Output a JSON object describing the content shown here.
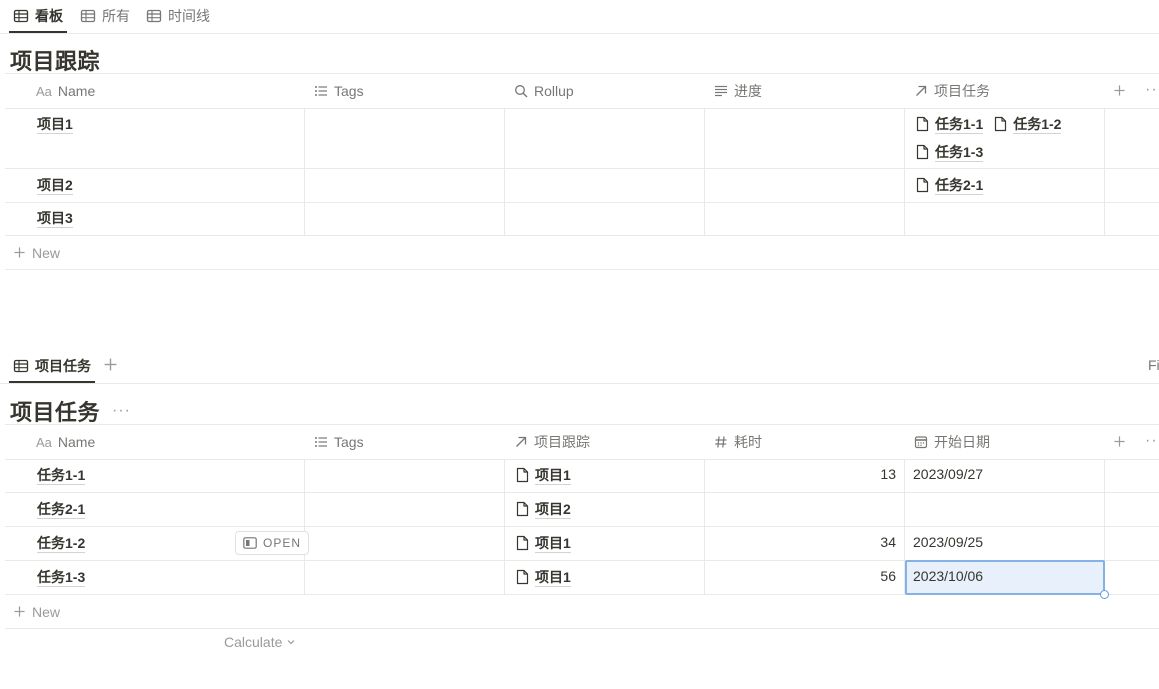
{
  "view1": {
    "tabs": [
      {
        "label": "看板",
        "active": true
      },
      {
        "label": "所有",
        "active": false
      },
      {
        "label": "时间线",
        "active": false
      }
    ],
    "title": "项目跟踪",
    "columns": [
      "Name",
      "Tags",
      "Rollup",
      "进度",
      "项目任务"
    ],
    "name_prefix": "Aa",
    "rows": [
      {
        "name": "项目1",
        "relations": [
          "任务1-1",
          "任务1-2",
          "任务1-3"
        ]
      },
      {
        "name": "项目2",
        "relations": [
          "任务2-1"
        ]
      },
      {
        "name": "项目3",
        "relations": []
      }
    ],
    "new_label": "New"
  },
  "view2": {
    "tabs": [
      {
        "label": "项目任务",
        "active": true
      }
    ],
    "right_clip": "Fi",
    "title": "项目任务",
    "more": "···",
    "columns": [
      "Name",
      "Tags",
      "项目跟踪",
      "耗时",
      "开始日期"
    ],
    "name_prefix": "Aa",
    "rows": [
      {
        "name": "任务1-1",
        "project": "项目1",
        "duration": "13",
        "date": "2023/09/27"
      },
      {
        "name": "任务2-1",
        "project": "项目2",
        "duration": "",
        "date": ""
      },
      {
        "name": "任务1-2",
        "project": "项目1",
        "duration": "34",
        "date": "2023/09/25"
      },
      {
        "name": "任务1-3",
        "project": "项目1",
        "duration": "56",
        "date": "2023/10/06"
      }
    ],
    "open_label": "OPEN",
    "new_label": "New",
    "calculate_label": "Calculate"
  },
  "icons": {
    "table": "table-icon",
    "list": "list-icon",
    "search": "search-icon",
    "text": "text-lines-icon",
    "relation": "arrow-up-right-icon",
    "number": "hash-icon",
    "date": "calendar-icon",
    "page": "page-icon",
    "plus": "plus-icon",
    "more": "more-horizontal-icon"
  },
  "colors": {
    "text": "#37352f",
    "muted": "#787774",
    "border": "#e9e9e7",
    "selection_border": "#84b1e6",
    "selection_fill": "#e7f0fb"
  }
}
